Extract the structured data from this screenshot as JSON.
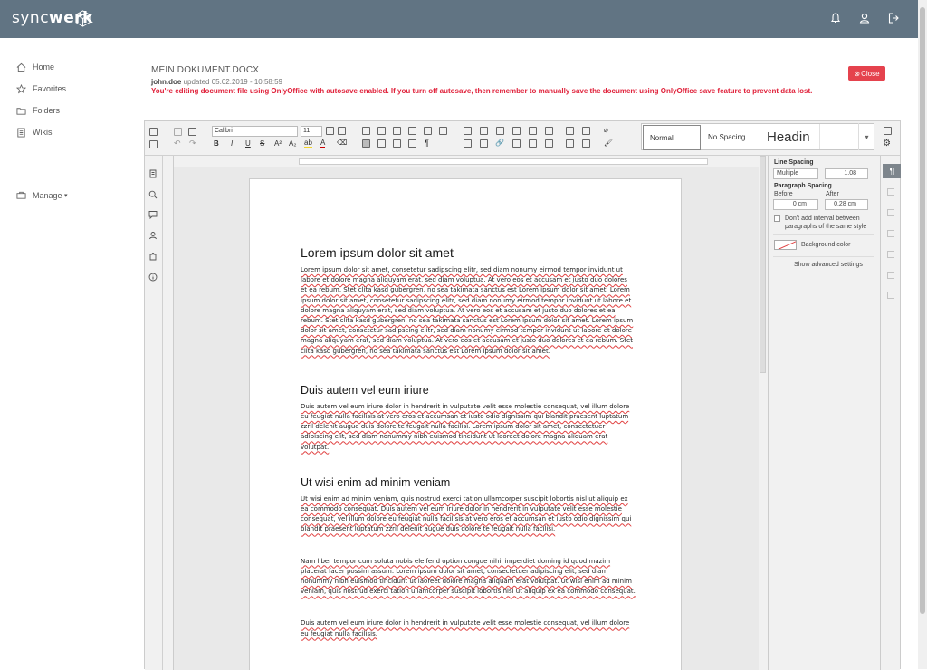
{
  "app": {
    "brand_light": "sync",
    "brand_bold": "werk"
  },
  "topbar": {
    "icons": [
      "bell-icon",
      "user-icon",
      "logout-icon"
    ]
  },
  "nav": {
    "items": [
      {
        "label": "Home",
        "icon": "home-icon"
      },
      {
        "label": "Favorites",
        "icon": "star-icon"
      },
      {
        "label": "Folders",
        "icon": "folder-icon"
      },
      {
        "label": "Wikis",
        "icon": "wiki-icon"
      }
    ],
    "manage": "Manage"
  },
  "doc": {
    "title": "MEIN DOKUMENT.DOCX",
    "user": "john.doe",
    "updated": "updated 05.02.2019 - 10:58:59",
    "warning": "You're editing document file using OnlyOffice with autosave enabled. If you turn off autosave, then remember to manually save the document using OnlyOffice save feature to prevent data lost.",
    "close_label": "Close"
  },
  "toolbar": {
    "font": "Calibri",
    "size": "11",
    "styles": {
      "normal": "Normal",
      "nospacing": "No Spacing",
      "heading": "Headin"
    }
  },
  "panel": {
    "line_spacing": "Line Spacing",
    "spacing_mode": "Multiple",
    "spacing_value": "1.08",
    "paragraph_spacing": "Paragraph Spacing",
    "before": "Before",
    "after": "After",
    "before_value": "0 cm",
    "after_value": "0.28 cm",
    "dont_add": "Don't add interval between paragraphs of the same style",
    "background_color": "Background color",
    "advanced": "Show advanced settings"
  },
  "content": {
    "h1": "Lorem ipsum dolor sit amet",
    "p1": "Lorem ipsum dolor sit amet, consetetur sadipscing elitr, sed diam nonumy eirmod tempor invidunt ut labore et dolore magna aliquyam erat, sed diam voluptua. At vero eos et accusam et justo duo dolores et ea rebum. Stet clita kasd gubergren, no sea takimata sanctus est Lorem ipsum dolor sit amet. Lorem ipsum dolor sit amet, consetetur sadipscing elitr, sed diam nonumy eirmod tempor invidunt ut labore et dolore magna aliquyam erat, sed diam voluptua. At vero eos et accusam et justo duo dolores et ea rebum. Stet clita kasd gubergren, no sea takimata sanctus est Lorem ipsum dolor sit amet. Lorem ipsum dolor sit amet, consetetur sadipscing elitr, sed diam nonumy eirmod tempor invidunt ut labore et dolore magna aliquyam erat, sed diam voluptua. At vero eos et accusam et justo duo dolores et ea rebum. Stet clita kasd gubergren, no sea takimata sanctus est Lorem ipsum dolor sit amet.",
    "h2a": "Duis autem vel eum iriure",
    "p2": "Duis autem vel eum iriure dolor in hendrerit in vulputate velit esse molestie consequat, vel illum dolore eu feugiat nulla facilisis at vero eros et accumsan et iusto odio dignissim qui blandit praesent luptatum zzril delenit augue duis dolore te feugait nulla facilisi. Lorem ipsum dolor sit amet, consectetuer adipiscing elit, sed diam nonummy nibh euismod tincidunt ut laoreet dolore magna aliquam erat volutpat.",
    "h2b": "Ut wisi enim ad minim veniam",
    "p3": "Ut wisi enim ad minim veniam, quis nostrud exerci tation ullamcorper suscipit lobortis nisl ut aliquip ex ea commodo consequat. Duis autem vel eum iriure dolor in hendrerit in vulputate velit esse molestie consequat, vel illum dolore eu feugiat nulla facilisis at vero eros et accumsan et iusto odio dignissim qui blandit praesent luptatum zzril delenit augue duis dolore te feugait nulla facilisi.",
    "p4": "Nam liber tempor cum soluta nobis eleifend option congue nihil imperdiet doming id quod mazim placerat facer possim assum. Lorem ipsum dolor sit amet, consectetuer adipiscing elit, sed diam nonummy nibh euismod tincidunt ut laoreet dolore magna aliquam erat volutpat. Ut wisi enim ad minim veniam, quis nostrud exerci tation ullamcorper suscipit lobortis nisl ut aliquip ex ea commodo consequat.",
    "p5": "Duis autem vel eum iriure dolor in hendrerit in vulputate velit esse molestie consequat, vel illum dolore eu feugiat nulla facilisis."
  }
}
